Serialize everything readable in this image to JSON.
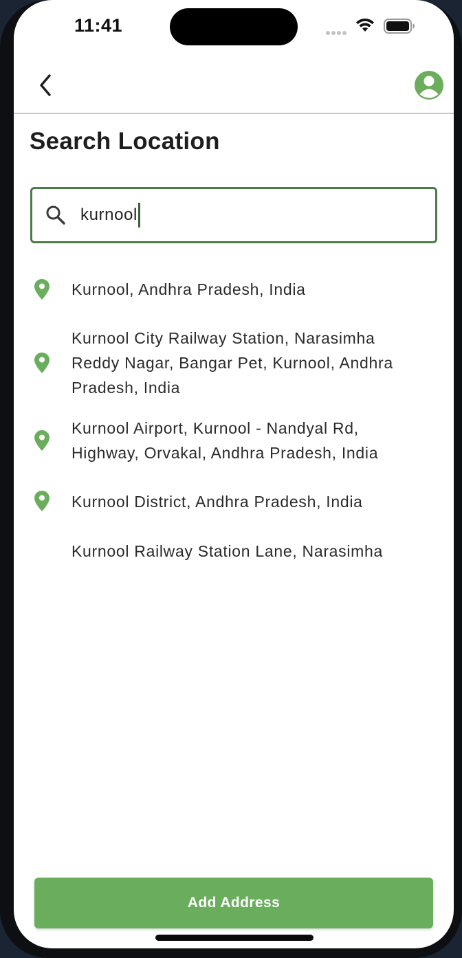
{
  "status_bar": {
    "time": "11:41"
  },
  "header": {
    "back_icon": "chevron-left-icon",
    "profile_icon": "account-circle-icon"
  },
  "page": {
    "title": "Search Location"
  },
  "search": {
    "icon": "search-icon",
    "value": "kurnool"
  },
  "results": [
    {
      "icon": "location-pin-icon",
      "lines": [
        "Kurnool, Andhra Pradesh, India"
      ]
    },
    {
      "icon": "location-pin-icon",
      "lines": [
        "Kurnool City Railway Station, Narasimha",
        "Reddy Nagar, Bangar Pet, Kurnool, Andhra",
        "Pradesh, India"
      ]
    },
    {
      "icon": "location-pin-icon",
      "lines": [
        "Kurnool Airport, Kurnool - Nandyal Rd,",
        "Highway, Orvakal, Andhra Pradesh, India"
      ]
    },
    {
      "icon": "location-pin-icon",
      "lines": [
        "Kurnool District, Andhra Pradesh, India"
      ]
    },
    {
      "icon": "",
      "lines": [
        "Kurnool Railway Station Lane, Narasimha"
      ]
    }
  ],
  "footer": {
    "button_label": "Add Address"
  },
  "colors": {
    "accent": "#6aae5d",
    "search_border": "#4e7a48",
    "text": "#2a2a2a"
  }
}
